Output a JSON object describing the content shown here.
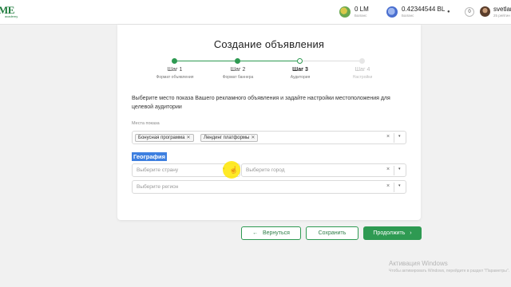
{
  "header": {
    "logo": "ME",
    "logo_sub": "academy",
    "wallets": [
      {
        "amount": "0 LM",
        "caption": "Баланс"
      },
      {
        "amount": "0.42344544 BL",
        "caption": "Баланс"
      }
    ],
    "bell_icon": "bell-icon",
    "notification_count": "0",
    "user_name": "svetlan",
    "user_rating": "25 рейтин"
  },
  "page": {
    "title": "Создание объявления"
  },
  "steps": [
    {
      "label": "Шаг 1",
      "sub": "Формат объявления",
      "state": "done"
    },
    {
      "label": "Шаг 2",
      "sub": "Формат баннера",
      "state": "done"
    },
    {
      "label": "Шаг 3",
      "sub": "Аудитория",
      "state": "active"
    },
    {
      "label": "Шаг 4",
      "sub": "Настройки",
      "state": "todo"
    }
  ],
  "form": {
    "instructions": "Выберите место показа Вашего рекламного объявления и задайте настройки местоположения для целевой аудитории",
    "placement_label": "Места показа",
    "placement_chips": [
      "Бонусная программа",
      "Лендинг платформы"
    ],
    "geo_label": "География",
    "country_placeholder": "Выберите страну",
    "city_placeholder": "Выберите город",
    "region_placeholder": "Выберите регион",
    "clear_glyph": "×",
    "caret_glyph": "▾"
  },
  "buttons": {
    "back_label": "Вернуться",
    "save_label": "Сохранить",
    "next_label": "Продолжить"
  },
  "watermark": {
    "title": "Активация Windows",
    "subtitle": "Чтобы активировать Windows, перейдите в раздел \"Параметры\"."
  },
  "colors": {
    "accent": "#2e9a52",
    "selection": "#3d7fe0",
    "cursor_highlight": "#ffe600"
  }
}
